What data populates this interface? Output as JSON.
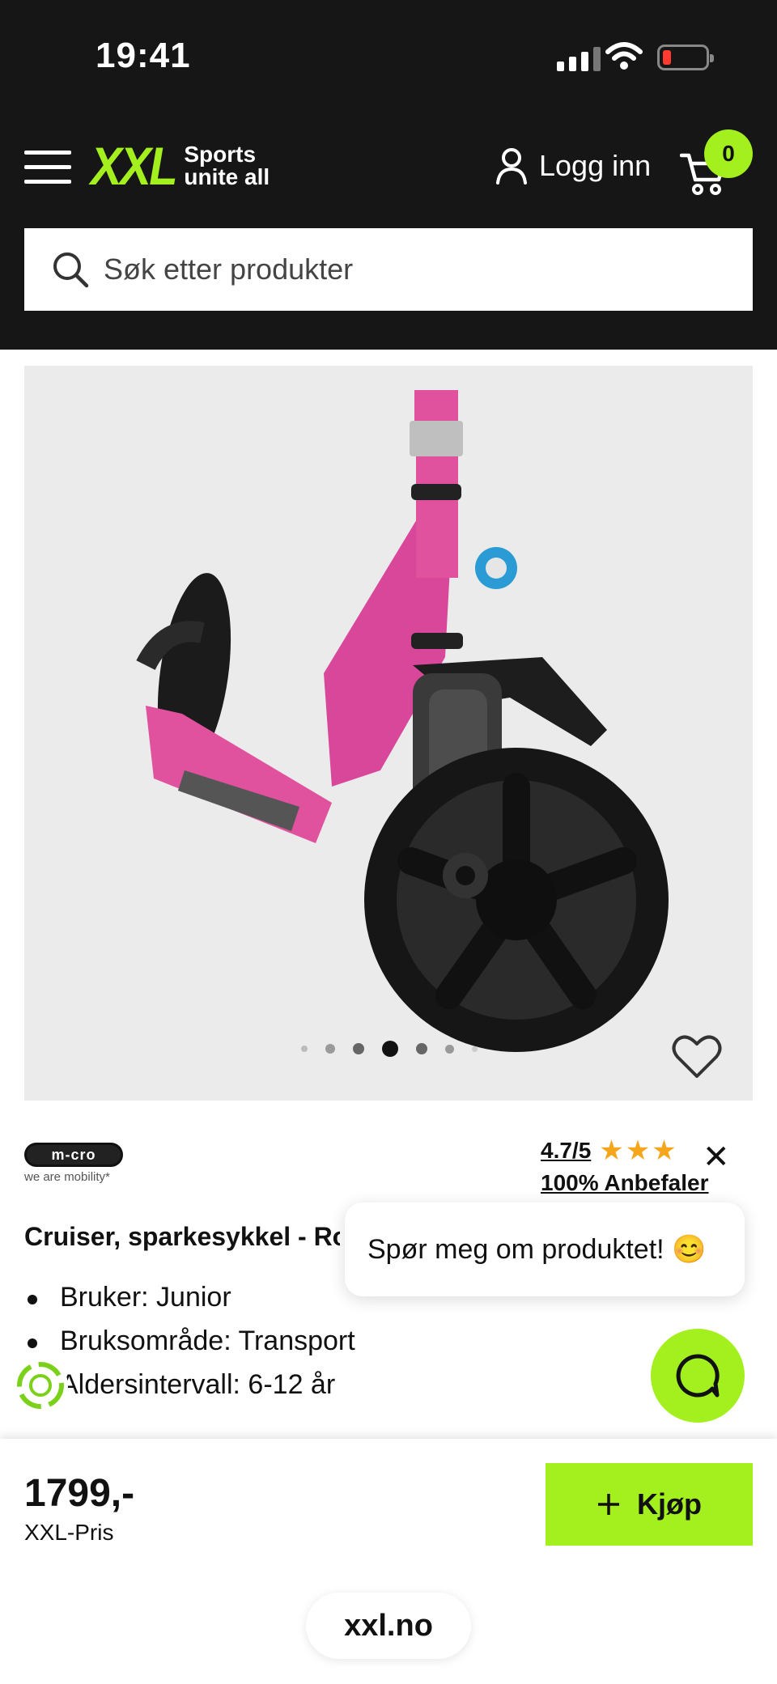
{
  "status_bar": {
    "time": "19:41"
  },
  "header": {
    "logo_mark": "XXL",
    "logo_tagline_1": "Sports",
    "logo_tagline_2": "unite all",
    "login_label": "Logg inn",
    "cart_count": "0"
  },
  "search": {
    "placeholder": "Søk etter produkter"
  },
  "gallery": {
    "dot_count": 7,
    "active_dot": 3
  },
  "brand": {
    "name": "m-cro",
    "tagline": "we are mobility*"
  },
  "rating": {
    "score": "4.7/5",
    "stars": "★★★",
    "recommend": "100% Anbefaler"
  },
  "product": {
    "title": "Cruiser, sparkesykkel - Rosa",
    "features": [
      "Bruker: Junior",
      "Bruksområde: Transport",
      "Aldersintervall: 6-12 år"
    ]
  },
  "chat": {
    "bubble_text": "Spør meg om produktet! 😊"
  },
  "purchase": {
    "price": "1799,-",
    "price_label": "XXL-Pris",
    "buy_label": "Kjøp"
  },
  "browser": {
    "url": "xxl.no"
  },
  "colors": {
    "accent": "#a3f01e",
    "header_bg": "#161616",
    "product_pink": "#e0529e",
    "star": "#f6a61a"
  }
}
